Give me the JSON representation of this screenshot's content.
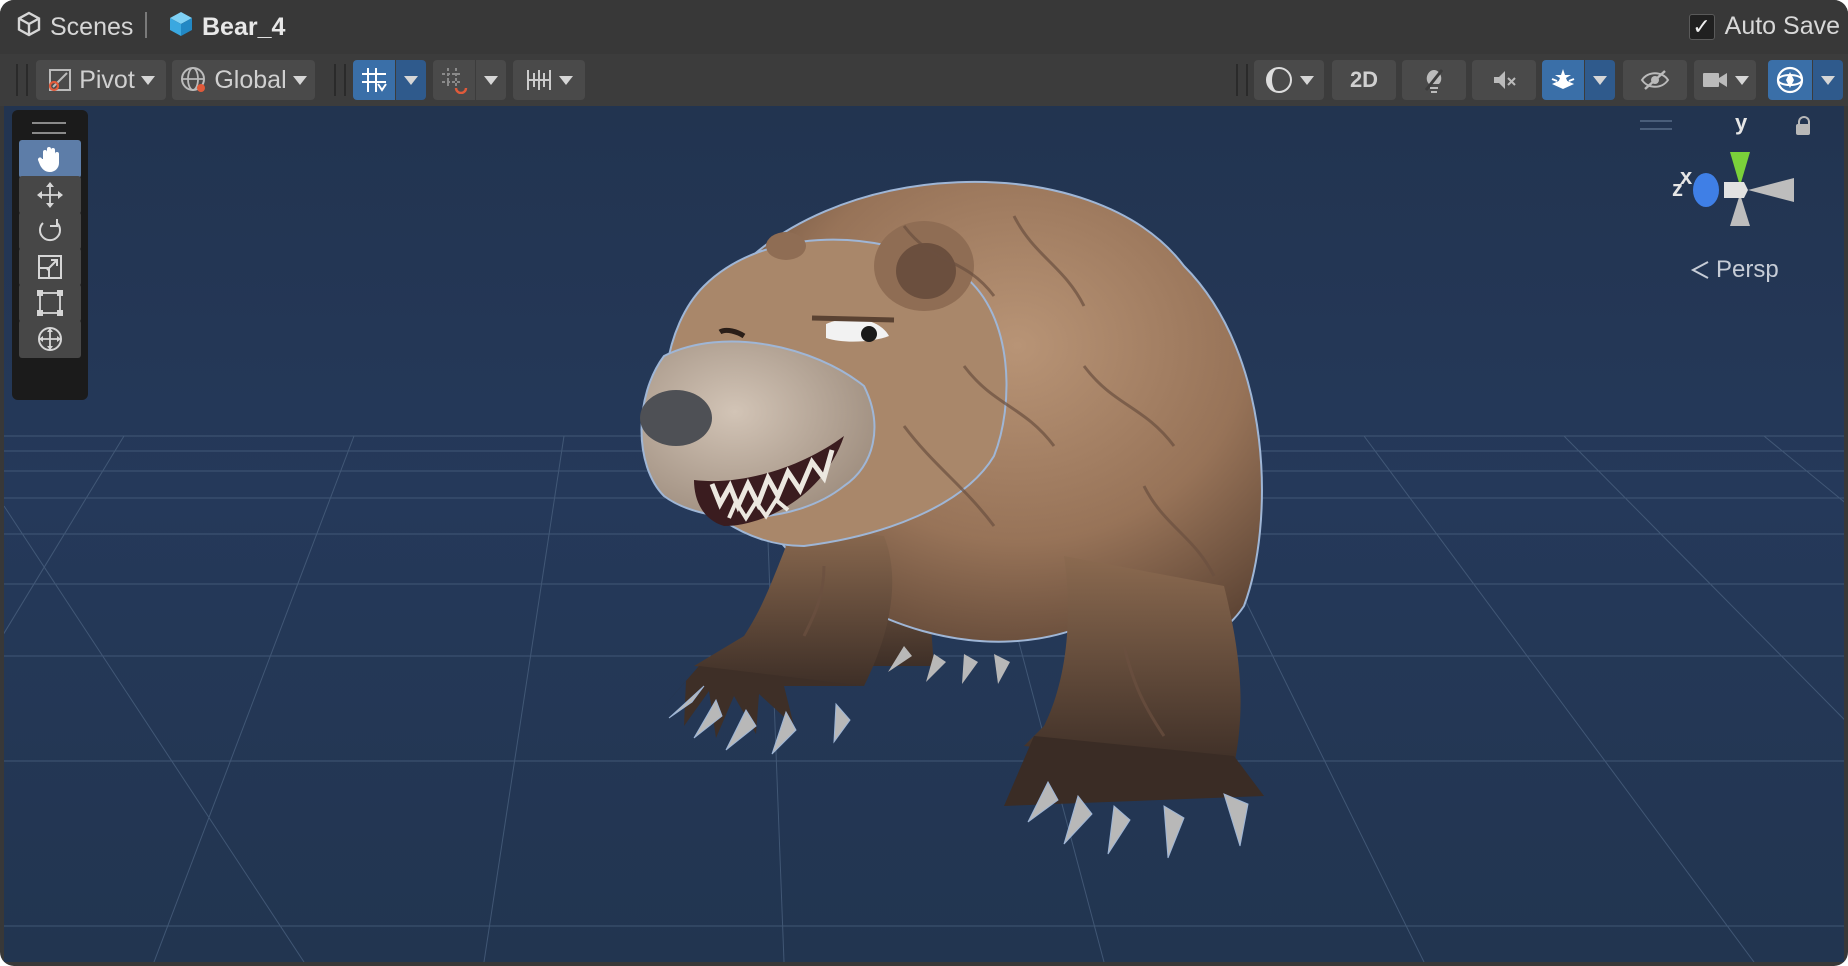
{
  "breadcrumb": {
    "root_label": "Scenes",
    "scene_label": "Bear_4"
  },
  "autosave": {
    "label": "Auto Save",
    "checked": true
  },
  "toolbar": {
    "pivot_label": "Pivot",
    "global_label": "Global",
    "twod_label": "2D"
  },
  "gizmo": {
    "y_label": "y",
    "x_label": "x",
    "z_label": "z",
    "projection_label": "Persp"
  },
  "colors": {
    "viewport_bg": "#233651",
    "accent": "#3a6fa8",
    "y_axis": "#7ad13a",
    "z_axis": "#3f7fe6"
  }
}
